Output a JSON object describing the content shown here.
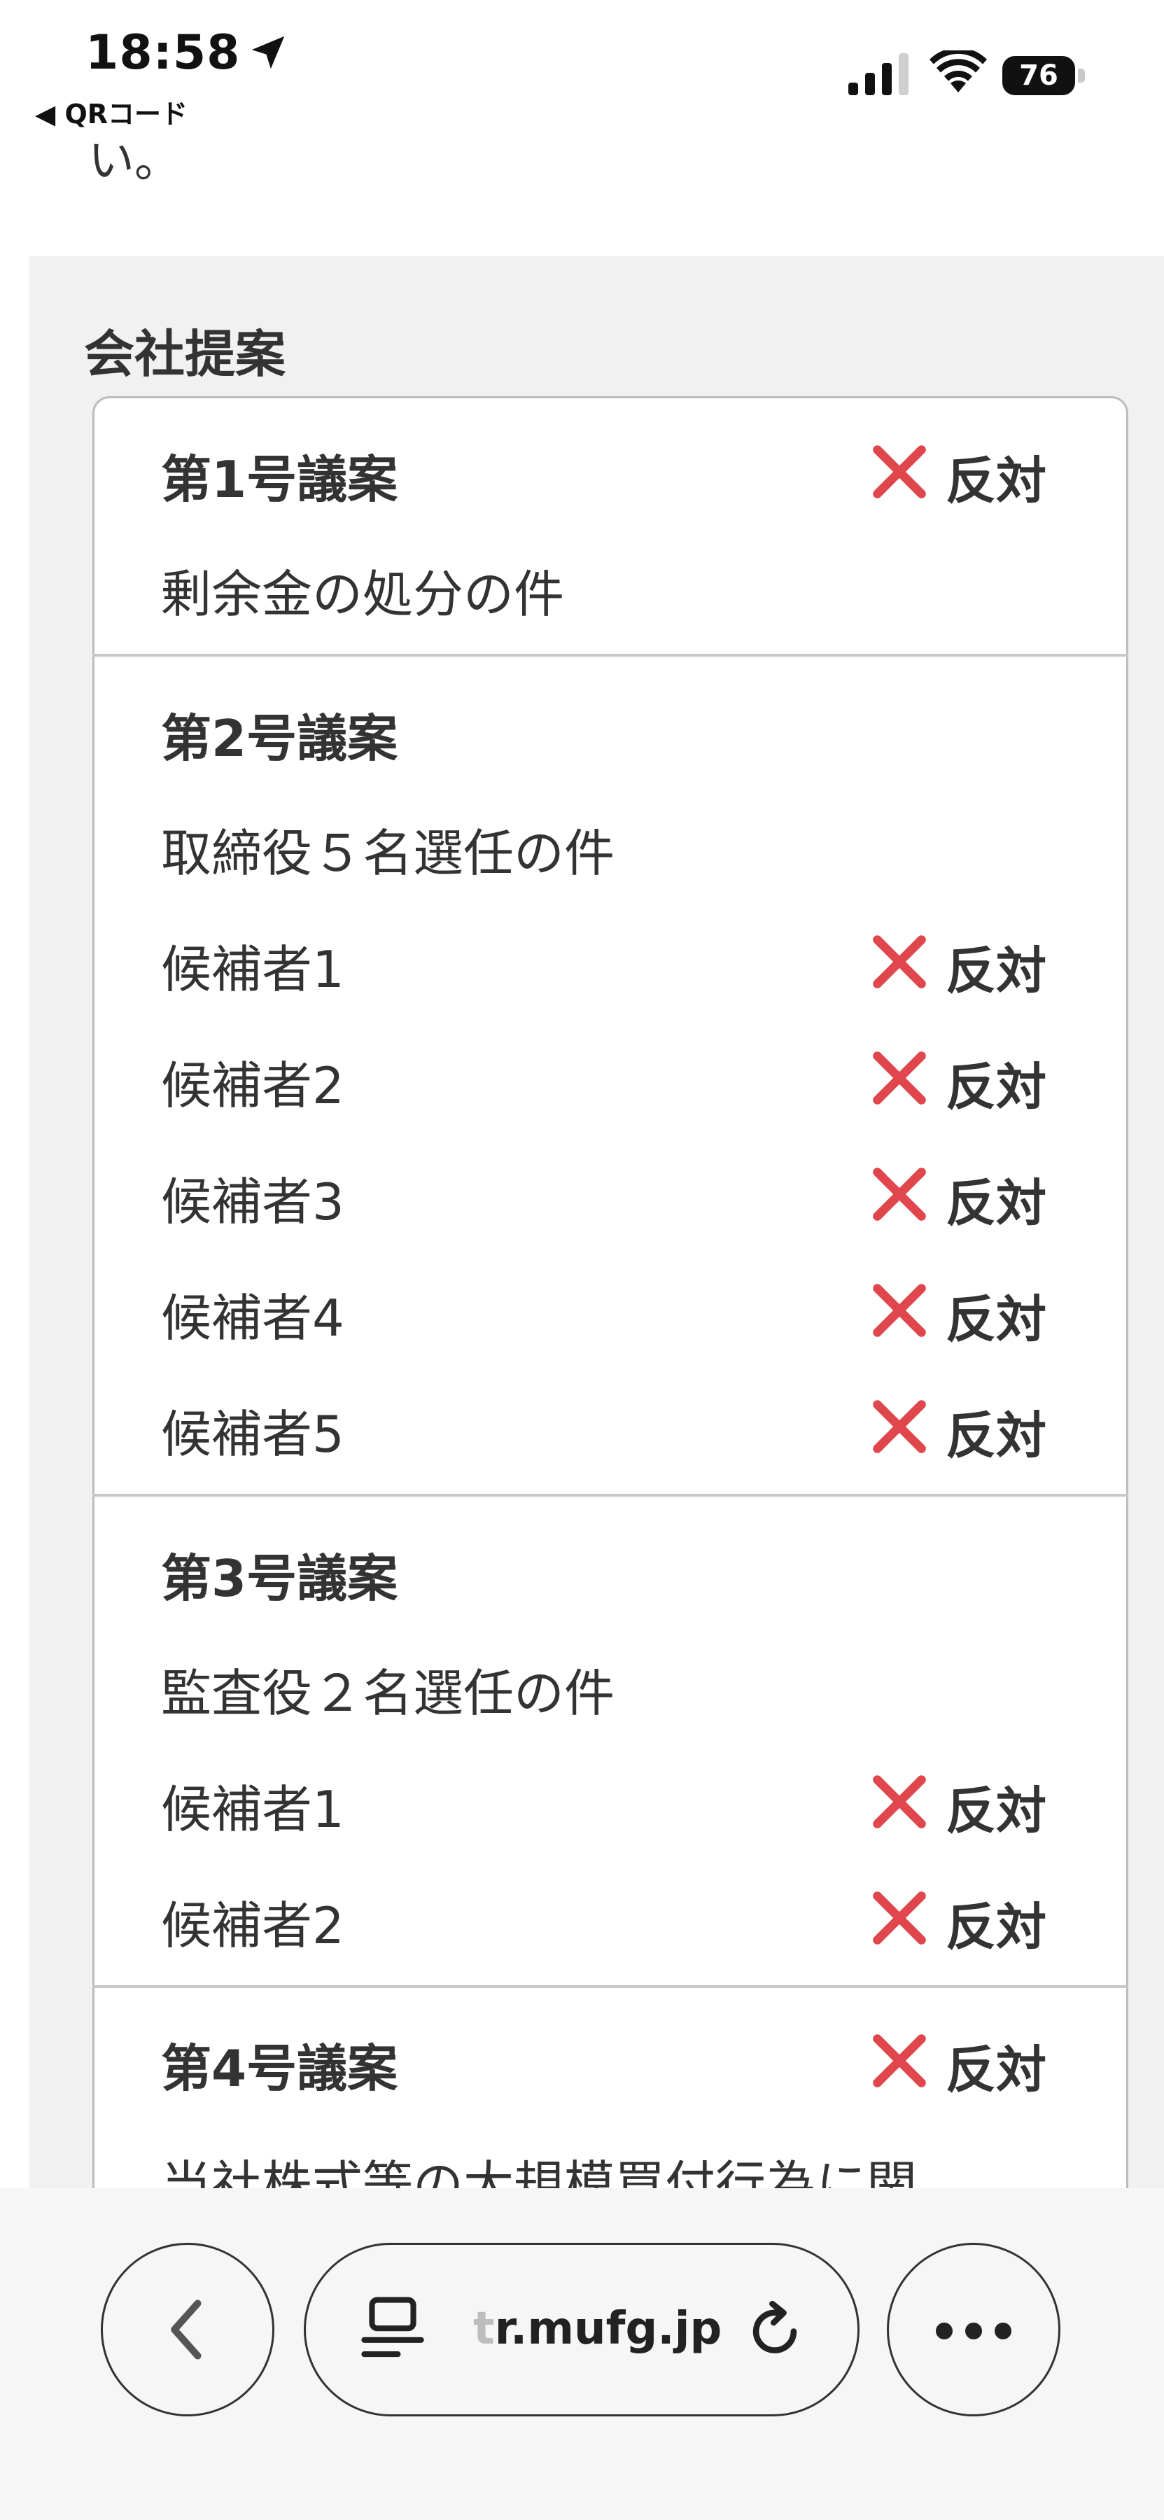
{
  "status_bar": {
    "time": "18:58",
    "back_app": "◀ QRコード",
    "battery": "76"
  },
  "intro_tail": "い。",
  "section": {
    "title": "会社提案"
  },
  "proposals": [
    {
      "heading": "第1号議案",
      "description": "剰余金の処分の件",
      "vote": "反対"
    },
    {
      "heading": "第2号議案",
      "description": "取締役５名選任の件",
      "candidates": [
        {
          "name": "候補者1",
          "vote": "反対"
        },
        {
          "name": "候補者2",
          "vote": "反対"
        },
        {
          "name": "候補者3",
          "vote": "反対"
        },
        {
          "name": "候補者4",
          "vote": "反対"
        },
        {
          "name": "候補者5",
          "vote": "反対"
        }
      ]
    },
    {
      "heading": "第3号議案",
      "description": "監査役２名選任の件",
      "candidates": [
        {
          "name": "候補者1",
          "vote": "反対"
        },
        {
          "name": "候補者2",
          "vote": "反対"
        }
      ]
    },
    {
      "heading": "第4号議案",
      "description": "当社株式等の大規模買付行為に関",
      "vote": "反対"
    }
  ],
  "browser": {
    "url_faded": "t",
    "url": "r.mufg.jp"
  },
  "colors": {
    "vote_x": "#e0474c",
    "section_bg": "#f1f1f1",
    "divider": "#c7c7c7"
  },
  "icons": {
    "location": "location-arrow-icon",
    "signal": "cellular-signal-icon",
    "wifi": "wifi-icon",
    "back": "chevron-left-icon",
    "page": "page-summary-icon",
    "reload": "reload-icon",
    "more": "more-dots-icon",
    "vote": "x-mark-icon"
  }
}
